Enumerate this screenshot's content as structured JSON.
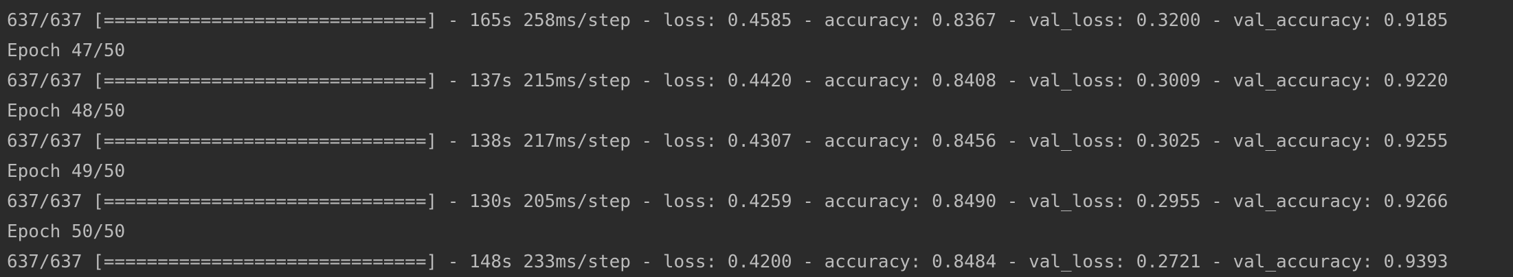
{
  "console": {
    "lines": [
      "637/637 [==============================] - 165s 258ms/step - loss: 0.4585 - accuracy: 0.8367 - val_loss: 0.3200 - val_accuracy: 0.9185",
      "Epoch 47/50",
      "637/637 [==============================] - 137s 215ms/step - loss: 0.4420 - accuracy: 0.8408 - val_loss: 0.3009 - val_accuracy: 0.9220",
      "Epoch 48/50",
      "637/637 [==============================] - 138s 217ms/step - loss: 0.4307 - accuracy: 0.8456 - val_loss: 0.3025 - val_accuracy: 0.9255",
      "Epoch 49/50",
      "637/637 [==============================] - 130s 205ms/step - loss: 0.4259 - accuracy: 0.8490 - val_loss: 0.2955 - val_accuracy: 0.9266",
      "Epoch 50/50",
      "637/637 [==============================] - 148s 233ms/step - loss: 0.4200 - accuracy: 0.8484 - val_loss: 0.2721 - val_accuracy: 0.9393"
    ]
  },
  "colors": {
    "background": "#2b2b2b",
    "text": "#bbbbbb"
  }
}
